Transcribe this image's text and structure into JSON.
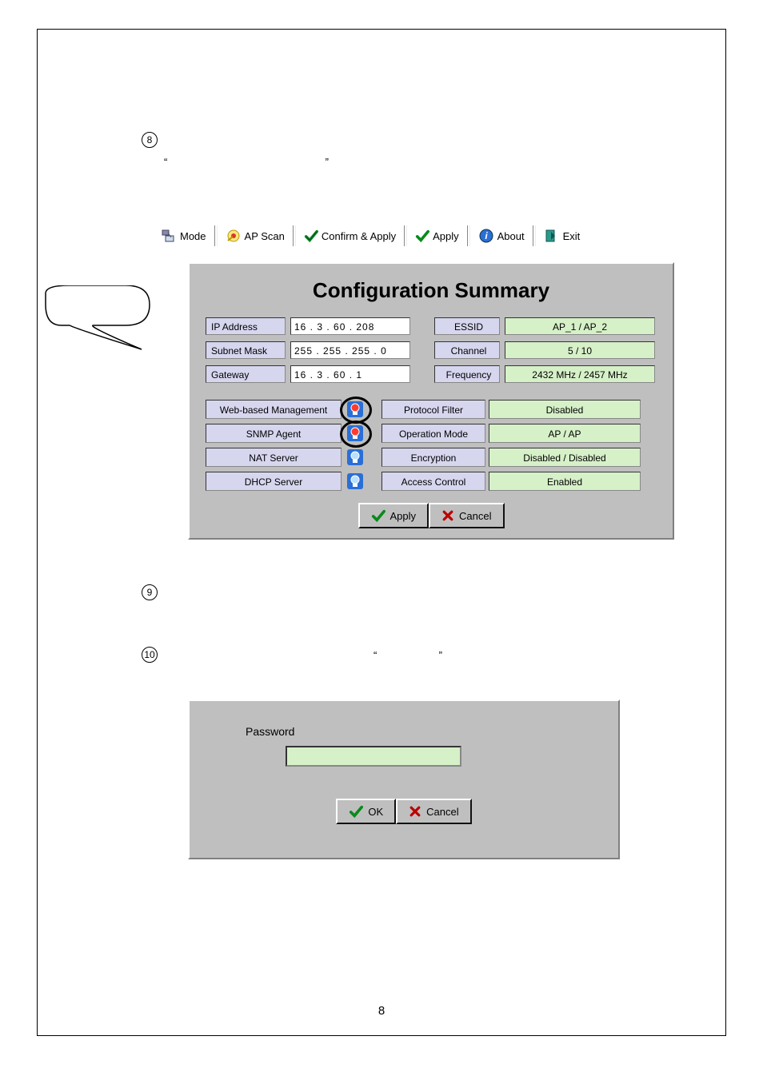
{
  "steps": {
    "s8_num": "8",
    "s8_quote_left": "“",
    "s8_quote_right": "”",
    "s9_num": "9",
    "s10_num": "10",
    "s10_quote_left": "“",
    "s10_quote_right": "”"
  },
  "toolbar": {
    "mode": "Mode",
    "ap_scan": "AP Scan",
    "confirm_apply": "Confirm & Apply",
    "apply": "Apply",
    "about": "About",
    "exit": "Exit"
  },
  "config": {
    "title": "Configuration Summary",
    "left_labels": {
      "ip": "IP Address",
      "mask": "Subnet Mask",
      "gw": "Gateway"
    },
    "left_values": {
      "ip": "16 .  3  . 60 . 208",
      "mask": "255 . 255 . 255 .  0",
      "gw": "16 .  3  . 60 .  1"
    },
    "right_labels": {
      "essid": "ESSID",
      "channel": "Channel",
      "freq": "Frequency"
    },
    "right_values": {
      "essid": "AP_1 / AP_2",
      "channel": "5 / 10",
      "freq": "2432 MHz / 2457 MHz"
    },
    "mid_rows": [
      {
        "label": "Web-based Management",
        "on": true,
        "circled": true,
        "label2": "Protocol Filter",
        "value": "Disabled"
      },
      {
        "label": "SNMP Agent",
        "on": true,
        "circled": true,
        "label2": "Operation Mode",
        "value": "AP / AP"
      },
      {
        "label": "NAT Server",
        "on": false,
        "circled": false,
        "label2": "Encryption",
        "value": "Disabled / Disabled"
      },
      {
        "label": "DHCP Server",
        "on": false,
        "circled": false,
        "label2": "Access Control",
        "value": "Enabled"
      }
    ],
    "apply": "Apply",
    "cancel": "Cancel"
  },
  "password_dialog": {
    "label": "Password",
    "value": "",
    "ok": "OK",
    "cancel": "Cancel"
  },
  "page_number": "8"
}
